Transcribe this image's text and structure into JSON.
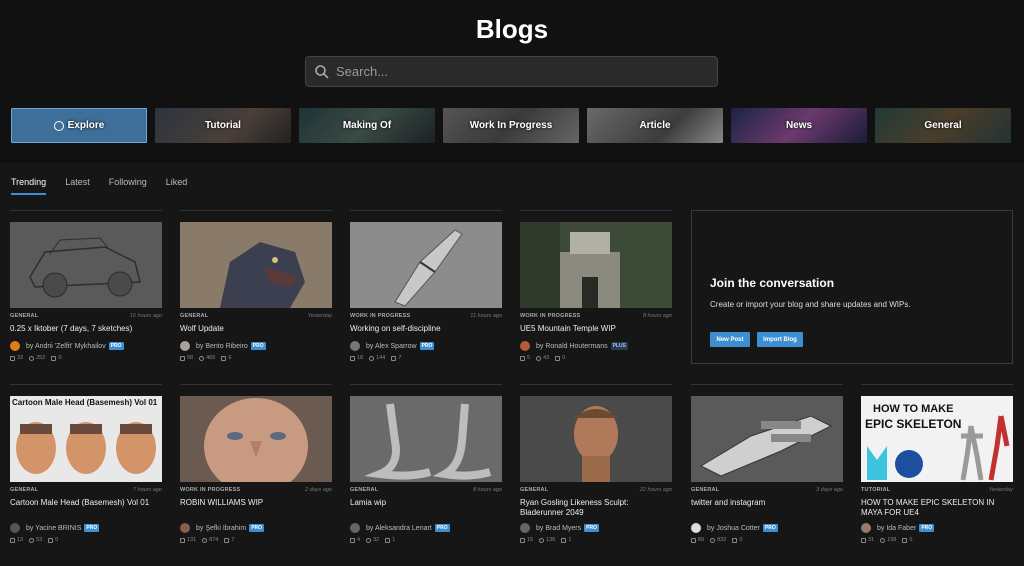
{
  "header": {
    "title": "Blogs",
    "search_placeholder": "Search..."
  },
  "categories": [
    {
      "label": "Explore",
      "active": true
    },
    {
      "label": "Tutorial"
    },
    {
      "label": "Making Of"
    },
    {
      "label": "Work In Progress"
    },
    {
      "label": "Article"
    },
    {
      "label": "News"
    },
    {
      "label": "General"
    }
  ],
  "tabs": [
    {
      "label": "Trending",
      "active": true
    },
    {
      "label": "Latest"
    },
    {
      "label": "Following"
    },
    {
      "label": "Liked"
    }
  ],
  "cards": [
    {
      "category": "GENERAL",
      "time": "16 hours ago",
      "title": "0.25 x Iktober (7 days, 7 sketches)",
      "author": "by Andrii 'Zelfit' Mykhailov",
      "badge": "PRO",
      "likes": "33",
      "views": "252",
      "comments": "0"
    },
    {
      "category": "GENERAL",
      "time": "Yesterday",
      "title": "Wolf Update",
      "author": "by Bento Ribeiro",
      "badge": "PRO",
      "likes": "58",
      "views": "465",
      "comments": "6"
    },
    {
      "category": "WORK IN PROGRESS",
      "time": "11 hours ago",
      "title": "Working on self-discipline",
      "author": "by Alex Sparrow",
      "badge": "PRO",
      "likes": "18",
      "views": "144",
      "comments": "7"
    },
    {
      "category": "WORK IN PROGRESS",
      "time": "8 hours ago",
      "title": "UE5 Mountain Temple WIP",
      "author": "by Ronald Houtermans",
      "badge": "PLUS",
      "likes": "5",
      "views": "43",
      "comments": "0"
    },
    {
      "category": "GENERAL",
      "time": "7 hours ago",
      "title": "Cartoon Male Head (Basemesh) Vol 01",
      "author": "by Yacine BRINIS",
      "badge": "PRO",
      "likes": "13",
      "views": "53",
      "comments": "0",
      "thumb_text": "Cartoon Male Head (Basemesh) Vol 01"
    },
    {
      "category": "WORK IN PROGRESS",
      "time": "2 days ago",
      "title": "ROBIN WILLIAMS WIP",
      "author": "by Şefki Ibrahim",
      "badge": "PRO",
      "likes": "131",
      "views": "874",
      "comments": "7"
    },
    {
      "category": "GENERAL",
      "time": "8 hours ago",
      "title": "Lamia wip",
      "author": "by Aleksandra Lenart",
      "badge": "PRO",
      "likes": "4",
      "views": "32",
      "comments": "1"
    },
    {
      "category": "GENERAL",
      "time": "22 hours ago",
      "title": "Ryan Gosling Likeness Sculpt: Bladerunner 2049",
      "author": "by Brad Myers",
      "badge": "PRO",
      "likes": "15",
      "views": "136",
      "comments": "1"
    },
    {
      "category": "GENERAL",
      "time": "3 days ago",
      "title": "twitter and instagram",
      "author": "by Joshua Cotter",
      "badge": "PRO",
      "likes": "89",
      "views": "832",
      "comments": "0"
    },
    {
      "category": "TUTORIAL",
      "time": "Yesterday",
      "title": "HOW TO MAKE EPIC SKELETON IN MAYA FOR UE4",
      "author": "by Ida Faber",
      "badge": "PRO",
      "likes": "31",
      "views": "198",
      "comments": "0",
      "thumb_text1": "HOW TO MAKE",
      "thumb_text2": "EPIC SKELETON"
    }
  ],
  "join": {
    "title": "Join the conversation",
    "description": "Create or import your blog and share updates and WIPs.",
    "new_post": "New Post",
    "import_blog": "Import Blog"
  },
  "colors": {
    "accent": "#3d8fd1",
    "background": "#161616"
  }
}
